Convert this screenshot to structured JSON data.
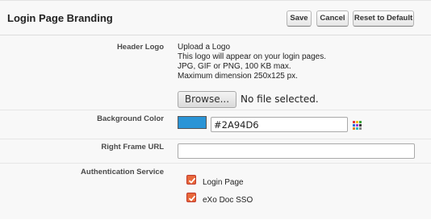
{
  "header": {
    "title": "Login Page Branding",
    "save_label": "Save",
    "cancel_label": "Cancel",
    "reset_label": "Reset to Default"
  },
  "header_logo": {
    "label": "Header Logo",
    "lines": [
      "Upload a Logo",
      "This logo will appear on your login pages.",
      "JPG, GIF or PNG, 100 KB max.",
      "Maximum dimension 250x125 px."
    ],
    "browse_label": "Browse...",
    "file_status": "No file selected."
  },
  "background_color": {
    "label": "Background Color",
    "value": "#2A94D6",
    "swatch_color": "#2A94D6",
    "picker_icon": "color-palette-icon"
  },
  "right_frame_url": {
    "label": "Right Frame URL",
    "value": ""
  },
  "authentication_service": {
    "label": "Authentication Service",
    "options": [
      {
        "label": "Login Page",
        "checked": true
      },
      {
        "label": "eXo Doc SSO",
        "checked": true
      }
    ]
  },
  "colors": {
    "checkbox_accent": "#E8683A"
  }
}
